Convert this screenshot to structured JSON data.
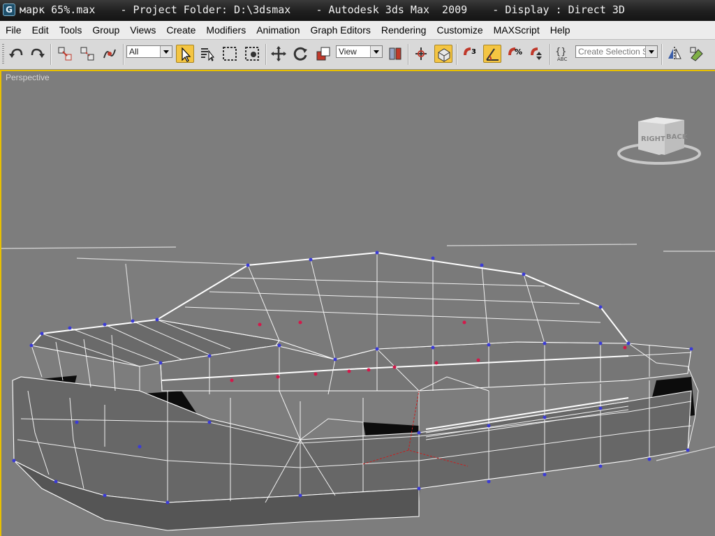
{
  "title_bar": {
    "text": "марк 65%.max    - Project Folder: D:\\3dsmax    - Autodesk 3ds Max  2009    - Display : Direct 3D"
  },
  "menu": {
    "items": [
      "File",
      "Edit",
      "Tools",
      "Group",
      "Views",
      "Create",
      "Modifiers",
      "Animation",
      "Graph Editors",
      "Rendering",
      "Customize",
      "MAXScript",
      "Help"
    ]
  },
  "toolbar": {
    "selection_filter": "All",
    "reference_coord": "View",
    "named_selection_set": "Create Selection S",
    "icons": [
      "undo-icon",
      "redo-icon",
      "select-and-link-icon",
      "unlink-selection-icon",
      "bind-to-space-warp-icon",
      "select-object-icon",
      "select-by-name-icon",
      "rectangular-selection-icon",
      "window-crossing-icon",
      "select-and-move-icon",
      "select-and-rotate-icon",
      "select-and-scale-icon",
      "use-pivot-center-icon",
      "select-and-manipulate-icon",
      "keyboard-shortcut-override-icon",
      "snaps-toggle-icon",
      "angle-snap-icon",
      "percent-snap-icon",
      "spinner-snap-icon",
      "edit-named-selection-icon",
      "mirror-icon",
      "align-icon"
    ]
  },
  "viewport": {
    "label": "Perspective",
    "viewcube_faces": [
      "RIGHT",
      "BACK"
    ]
  },
  "colors": {
    "viewport_bg": "#7d7d7d",
    "active_border": "#e8c000",
    "wire": "#ffffff",
    "vertex": "#3b3bd6",
    "selected_vertex": "#d4184a"
  }
}
